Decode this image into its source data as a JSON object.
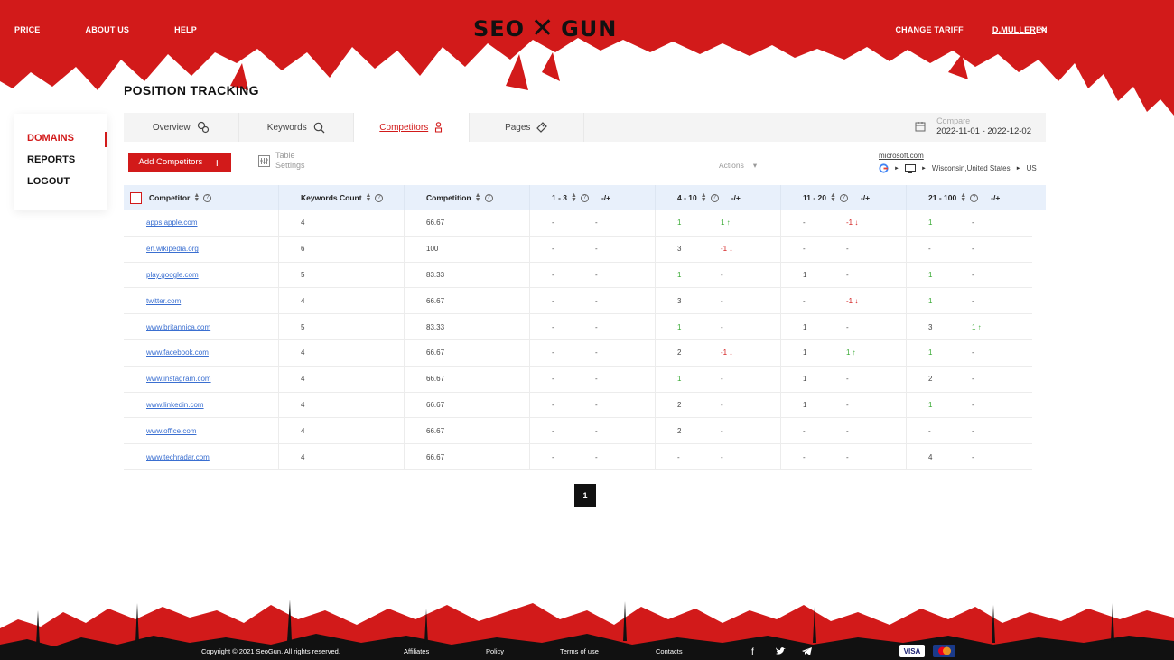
{
  "header": {
    "nav_left": [
      "PRICE",
      "ABOUT US",
      "HELP"
    ],
    "logo_left": "SEO",
    "logo_right": "GUN",
    "change_tariff": "CHANGE TARIFF",
    "user": "D.MULLER",
    "lang": "EN",
    "accent": "#d21a1a"
  },
  "page_title": "POSITION TRACKING",
  "sidebar": {
    "items": [
      {
        "label": "DOMAINS",
        "active": true
      },
      {
        "label": "REPORTS"
      },
      {
        "label": "LOGOUT"
      }
    ]
  },
  "tabs": [
    {
      "label": "Overview",
      "icon": "link-icon"
    },
    {
      "label": "Keywords",
      "icon": "search-icon"
    },
    {
      "label": "Competitors",
      "icon": "person-icon",
      "active": true
    },
    {
      "label": "Pages",
      "icon": "tag-icon"
    }
  ],
  "compare": {
    "label": "Compare",
    "range": "2022-11-01 - 2022-12-02"
  },
  "toolbar": {
    "add_label": "Add Competitors",
    "table_label": "Table",
    "settings_label": "Settings",
    "actions_label": "Actions"
  },
  "target": {
    "domain": "microsoft.com",
    "location": "Wisconsin,United States",
    "country": "US"
  },
  "table": {
    "headers": {
      "competitor": "Competitor",
      "keywords": "Keywords Count",
      "competition": "Competition",
      "r1": "1 - 3",
      "r2": "4 - 10",
      "r3": "11 - 20",
      "r4": "21 - 100",
      "delta": "-/+"
    },
    "rows": [
      {
        "domain": "apps.apple.com",
        "kw": "4",
        "comp": "66.67",
        "r": [
          [
            "-",
            "-"
          ],
          [
            "1",
            "1 ↑"
          ],
          [
            "-",
            "-1 ↓"
          ],
          [
            "1",
            "-"
          ]
        ]
      },
      {
        "domain": "en.wikipedia.org",
        "kw": "6",
        "comp": "100",
        "r": [
          [
            "-",
            "-"
          ],
          [
            "3",
            "-1 ↓"
          ],
          [
            "-",
            "-"
          ],
          [
            "-",
            "-"
          ]
        ]
      },
      {
        "domain": "play.google.com",
        "kw": "5",
        "comp": "83.33",
        "r": [
          [
            "-",
            "-"
          ],
          [
            "1",
            "-"
          ],
          [
            "1",
            "-"
          ],
          [
            "1",
            "-"
          ]
        ]
      },
      {
        "domain": "twitter.com",
        "kw": "4",
        "comp": "66.67",
        "r": [
          [
            "-",
            "-"
          ],
          [
            "3",
            "-"
          ],
          [
            "-",
            "-1 ↓"
          ],
          [
            "1",
            "-"
          ]
        ]
      },
      {
        "domain": "www.britannica.com",
        "kw": "5",
        "comp": "83.33",
        "r": [
          [
            "-",
            "-"
          ],
          [
            "1",
            "-"
          ],
          [
            "1",
            "-"
          ],
          [
            "3",
            "1 ↑"
          ]
        ]
      },
      {
        "domain": "www.facebook.com",
        "kw": "4",
        "comp": "66.67",
        "r": [
          [
            "-",
            "-"
          ],
          [
            "2",
            "-1 ↓"
          ],
          [
            "1",
            "1 ↑"
          ],
          [
            "1",
            "-"
          ]
        ]
      },
      {
        "domain": "www.instagram.com",
        "kw": "4",
        "comp": "66.67",
        "r": [
          [
            "-",
            "-"
          ],
          [
            "1",
            "-"
          ],
          [
            "1",
            "-"
          ],
          [
            "2",
            "-"
          ]
        ]
      },
      {
        "domain": "www.linkedin.com",
        "kw": "4",
        "comp": "66.67",
        "r": [
          [
            "-",
            "-"
          ],
          [
            "2",
            "-"
          ],
          [
            "1",
            "-"
          ],
          [
            "1",
            "-"
          ]
        ]
      },
      {
        "domain": "www.office.com",
        "kw": "4",
        "comp": "66.67",
        "r": [
          [
            "-",
            "-"
          ],
          [
            "2",
            "-"
          ],
          [
            "-",
            "-"
          ],
          [
            "-",
            "-"
          ]
        ]
      },
      {
        "domain": "www.techradar.com",
        "kw": "4",
        "comp": "66.67",
        "r": [
          [
            "-",
            "-"
          ],
          [
            "-",
            "-"
          ],
          [
            "-",
            "-"
          ],
          [
            "4",
            "-"
          ]
        ]
      }
    ]
  },
  "pager": {
    "current": "1"
  },
  "footer": {
    "copyright": "Copyright © 2021 SeoGun. All rights reserved.",
    "links": [
      "Affiliates",
      "Policy",
      "Terms of use",
      "Contacts"
    ],
    "visa": "VISA"
  }
}
